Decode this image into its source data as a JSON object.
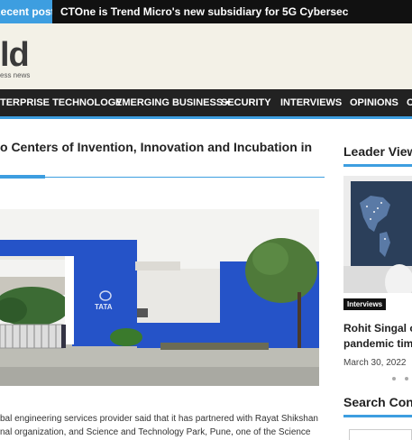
{
  "ticker": {
    "label": "Recent posts",
    "headline": "CTOne is Trend Micro's new subsidiary for 5G Cybersec"
  },
  "masthead": {
    "logo_text": "ld",
    "tagline": "ess news"
  },
  "nav": {
    "items": [
      {
        "label": "TERPRISE TECHNOLOGY"
      },
      {
        "label": "EMERGING BUSINESS"
      },
      {
        "label": "SECURITY"
      },
      {
        "label": "INTERVIEWS"
      },
      {
        "label": "OPINIONS"
      },
      {
        "label": "C"
      }
    ]
  },
  "article": {
    "title": "o Centers of Invention, Innovation and Incubation in",
    "photo_sign": "TATA",
    "body_line_1": "bal engineering services provider said that it has partnered with Rayat Shikshan",
    "body_line_2": "nal organization, and Science and Technology Park, Pune, one of the Science"
  },
  "sidebar": {
    "leader_view_heading": "Leader View",
    "badge": "Interviews",
    "news_title_line_1": "Rohit Singal o",
    "news_title_line_2": "pandemic tim",
    "news_date": "March 30, 2022",
    "search_heading": "Search Conte"
  },
  "colors": {
    "accent": "#3d9ee0",
    "nav_bg": "#222222",
    "masthead_bg": "#f3f1e7",
    "tata_blue": "#2553c8"
  }
}
